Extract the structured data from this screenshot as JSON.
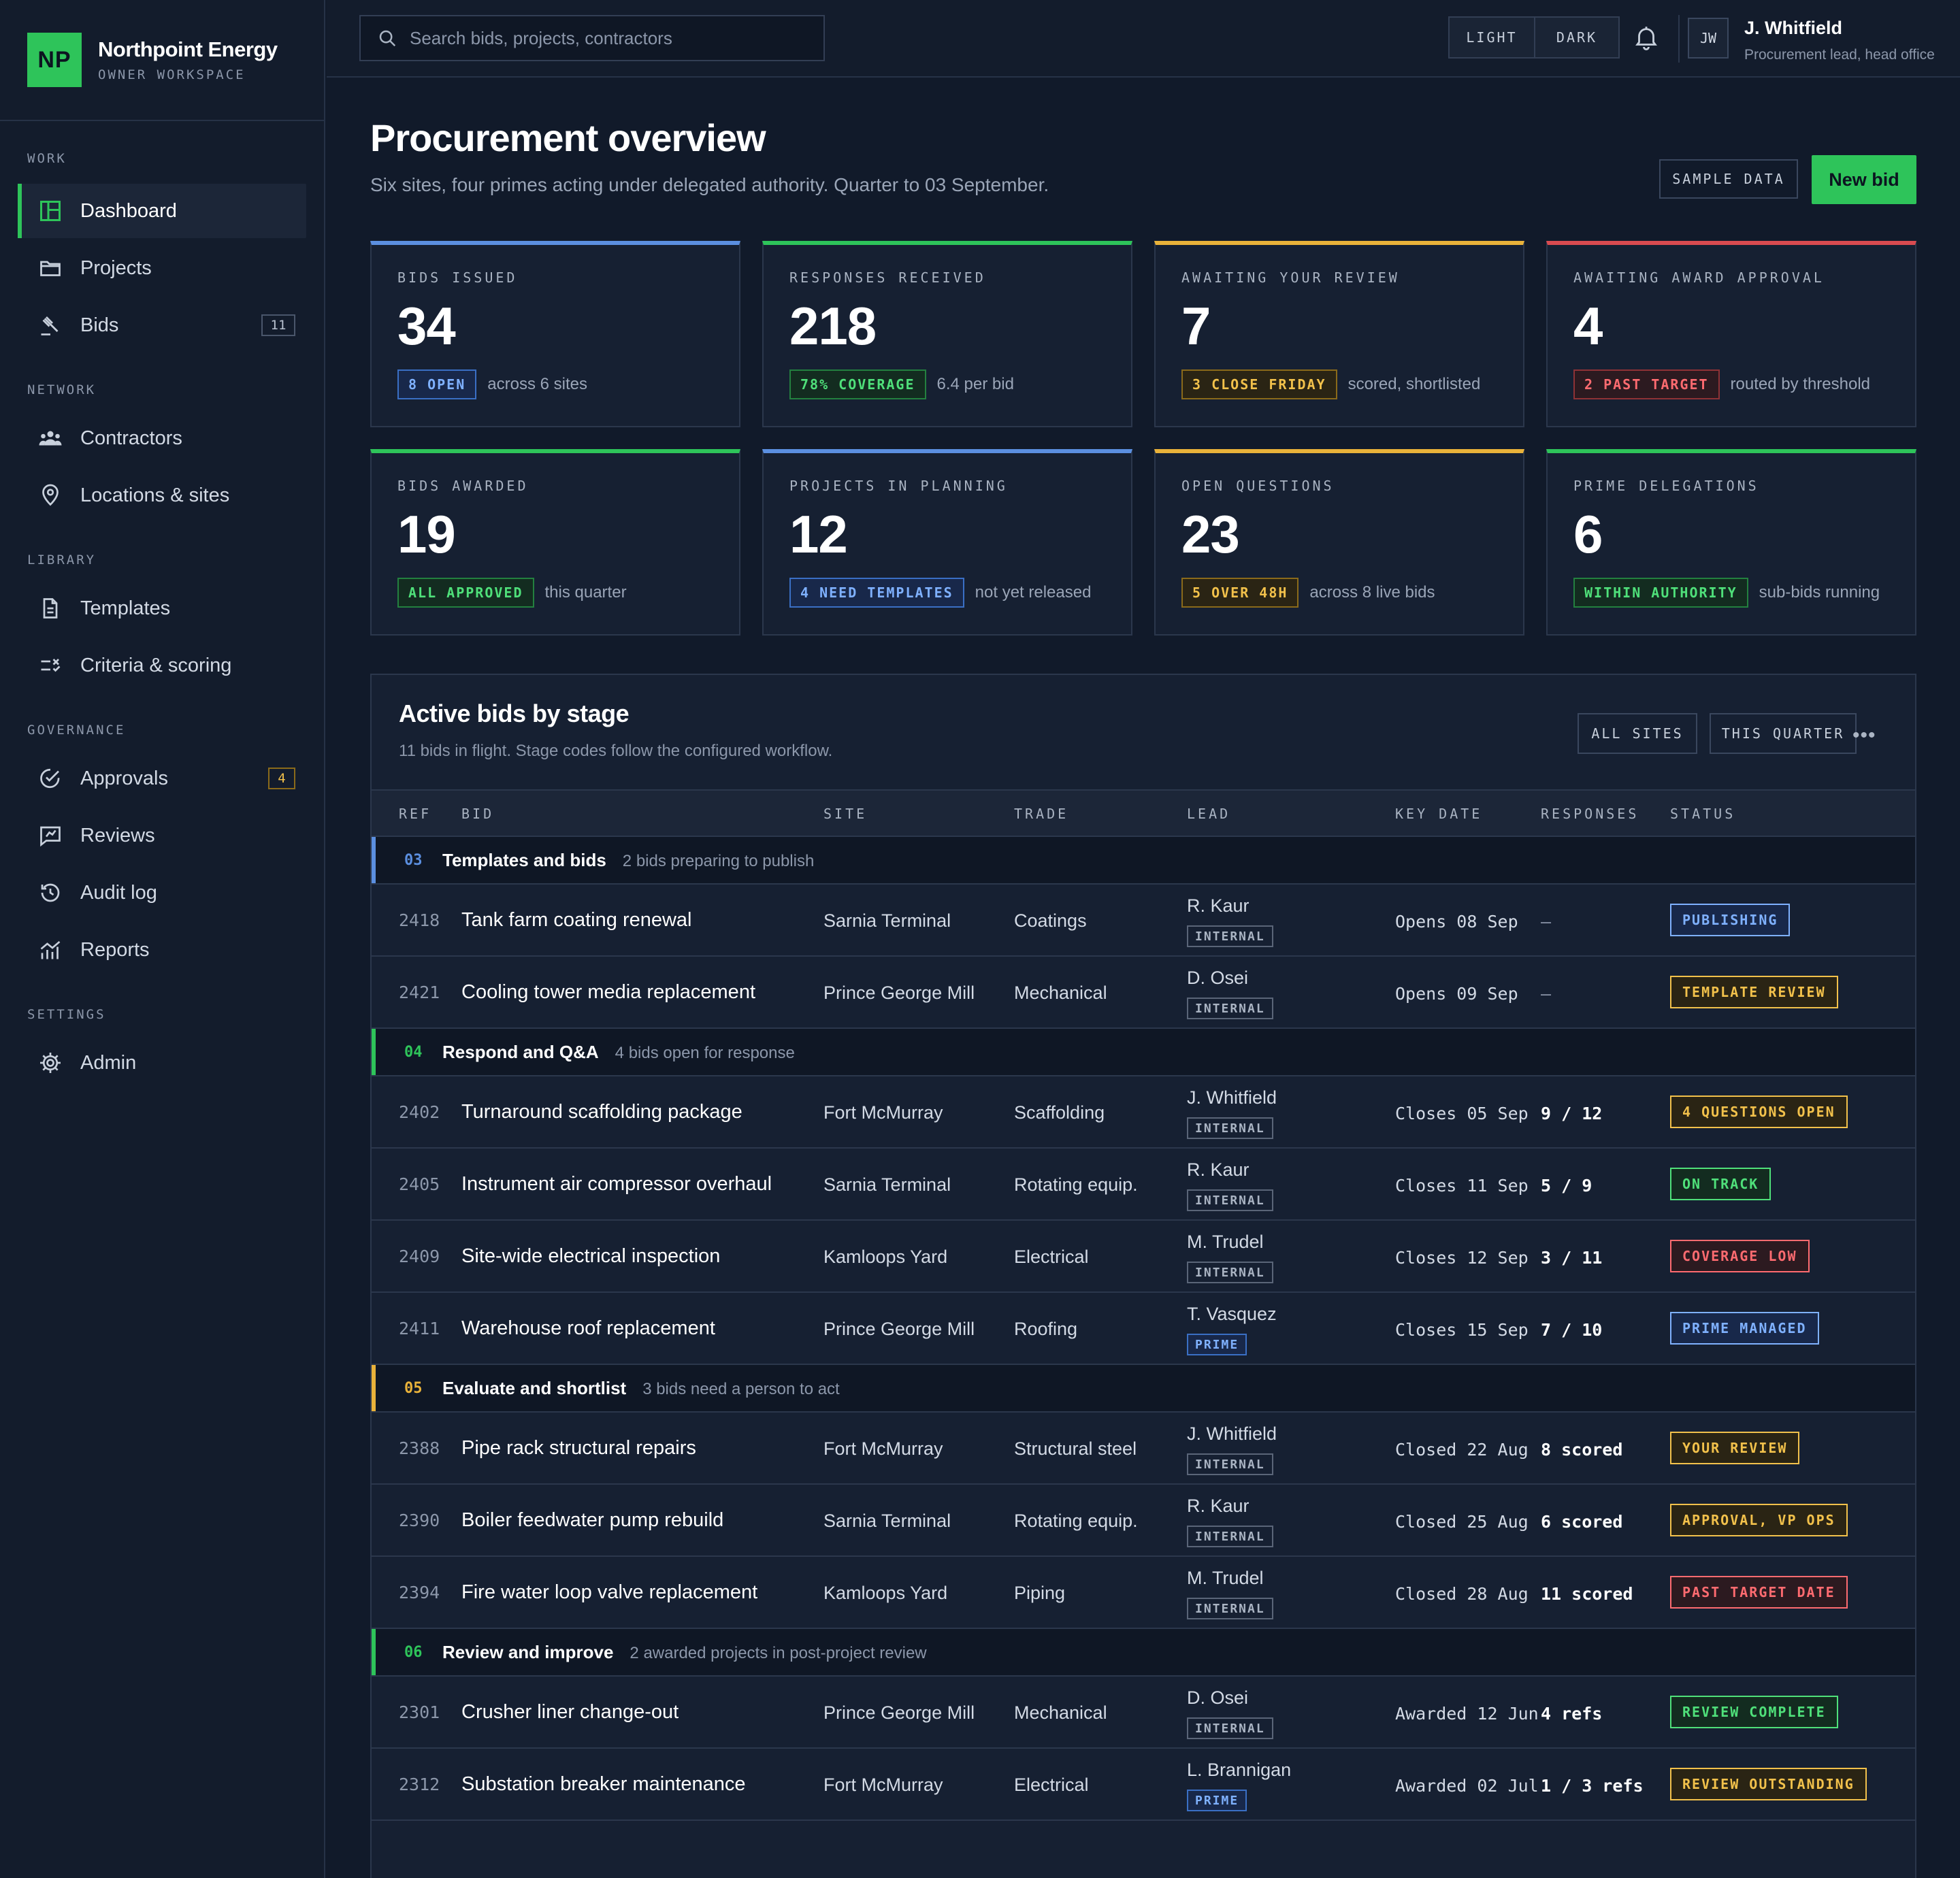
{
  "brand": {
    "logo": "NP",
    "name": "Northpoint Energy",
    "sub": "OWNER WORKSPACE"
  },
  "nav": {
    "work": {
      "heading": "WORK",
      "items": [
        {
          "label": "Dashboard",
          "icon": "dashboard-icon"
        },
        {
          "label": "Projects",
          "icon": "folder-icon"
        },
        {
          "label": "Bids",
          "icon": "gavel-icon",
          "count": "11"
        }
      ]
    },
    "network": {
      "heading": "NETWORK",
      "items": [
        {
          "label": "Contractors",
          "icon": "people-icon"
        },
        {
          "label": "Locations & sites",
          "icon": "map-pin-icon"
        }
      ]
    },
    "library": {
      "heading": "LIBRARY",
      "items": [
        {
          "label": "Templates",
          "icon": "document-icon"
        },
        {
          "label": "Criteria & scoring",
          "icon": "criteria-icon"
        }
      ]
    },
    "governance": {
      "heading": "GOVERNANCE",
      "items": [
        {
          "label": "Approvals",
          "icon": "check-circle-icon",
          "count": "4"
        },
        {
          "label": "Reviews",
          "icon": "review-icon"
        },
        {
          "label": "Audit log",
          "icon": "history-icon"
        },
        {
          "label": "Reports",
          "icon": "chart-icon"
        }
      ]
    },
    "settings": {
      "heading": "SETTINGS",
      "items": [
        {
          "label": "Admin",
          "icon": "gear-icon"
        }
      ]
    }
  },
  "topbar": {
    "search_placeholder": "Search bids, projects, contractors",
    "theme_light": "LIGHT",
    "theme_dark": "DARK",
    "user_initials": "JW",
    "user_name": "J. Whitfield",
    "user_role": "Procurement lead, head office"
  },
  "header": {
    "title": "Procurement overview",
    "subtitle": "Six sites, four primes acting under delegated authority. Quarter to 03 September.",
    "sample_label": "SAMPLE DATA",
    "new_bid_label": "New bid"
  },
  "kpis": [
    {
      "label": "BIDS ISSUED",
      "value": "34",
      "chip": "8 OPEN",
      "note": "across 6 sites",
      "color": "blue"
    },
    {
      "label": "RESPONSES RECEIVED",
      "value": "218",
      "chip": "78% COVERAGE",
      "note": "6.4 per bid",
      "color": "green"
    },
    {
      "label": "AWAITING YOUR REVIEW",
      "value": "7",
      "chip": "3 CLOSE FRIDAY",
      "note": "scored, shortlisted",
      "color": "amber"
    },
    {
      "label": "AWAITING AWARD APPROVAL",
      "value": "4",
      "chip": "2 PAST TARGET",
      "note": "routed by threshold",
      "color": "red"
    },
    {
      "label": "BIDS AWARDED",
      "value": "19",
      "chip": "ALL APPROVED",
      "note": "this quarter",
      "color": "green"
    },
    {
      "label": "PROJECTS IN PLANNING",
      "value": "12",
      "chip": "4 NEED TEMPLATES",
      "note": "not yet released",
      "color": "blue"
    },
    {
      "label": "OPEN QUESTIONS",
      "value": "23",
      "chip": "5 OVER 48H",
      "note": "across 8 live bids",
      "color": "amber"
    },
    {
      "label": "PRIME DELEGATIONS",
      "value": "6",
      "chip": "WITHIN AUTHORITY",
      "note": "sub-bids running",
      "color": "green"
    }
  ],
  "colors": {
    "blue": "#5b8fe0",
    "green": "#2ec45a",
    "amber": "#e9b23a",
    "red": "#d94b50"
  },
  "table": {
    "title": "Active bids by stage",
    "subtitle": "11 bids in flight. Stage codes follow the configured workflow.",
    "filter_sites": "ALL SITES",
    "filter_period": "THIS QUARTER",
    "more": "•••",
    "columns": [
      "REF",
      "BID",
      "SITE",
      "TRADE",
      "LEAD",
      "KEY DATE",
      "RESPONSES",
      "STATUS"
    ],
    "stages": [
      {
        "code": "03",
        "name": "Templates and bids",
        "desc": "2 bids preparing to publish",
        "color": "blue",
        "rows": [
          {
            "ref": "2418",
            "bid": "Tank farm coating renewal",
            "site": "Sarnia Terminal",
            "trade": "Coatings",
            "lead": "R. Kaur",
            "lead_tag": "INTERNAL",
            "key_date": "Opens 08 Sep",
            "responses": "—",
            "status": "PUBLISHING",
            "status_color": "blue"
          },
          {
            "ref": "2421",
            "bid": "Cooling tower media replacement",
            "site": "Prince George Mill",
            "trade": "Mechanical",
            "lead": "D. Osei",
            "lead_tag": "INTERNAL",
            "key_date": "Opens 09 Sep",
            "responses": "—",
            "status": "TEMPLATE REVIEW",
            "status_color": "amber"
          }
        ]
      },
      {
        "code": "04",
        "name": "Respond and Q&A",
        "desc": "4 bids open for response",
        "color": "green",
        "rows": [
          {
            "ref": "2402",
            "bid": "Turnaround scaffolding package",
            "site": "Fort McMurray",
            "trade": "Scaffolding",
            "lead": "J. Whitfield",
            "lead_tag": "INTERNAL",
            "key_date": "Closes 05 Sep",
            "responses": "9 / 12",
            "status": "4 QUESTIONS OPEN",
            "status_color": "amber"
          },
          {
            "ref": "2405",
            "bid": "Instrument air compressor overhaul",
            "site": "Sarnia Terminal",
            "trade": "Rotating equip.",
            "lead": "R. Kaur",
            "lead_tag": "INTERNAL",
            "key_date": "Closes 11 Sep",
            "responses": "5 / 9",
            "status": "ON TRACK",
            "status_color": "green"
          },
          {
            "ref": "2409",
            "bid": "Site-wide electrical inspection",
            "site": "Kamloops Yard",
            "trade": "Electrical",
            "lead": "M. Trudel",
            "lead_tag": "INTERNAL",
            "key_date": "Closes 12 Sep",
            "responses": "3 / 11",
            "status": "COVERAGE LOW",
            "status_color": "red"
          },
          {
            "ref": "2411",
            "bid": "Warehouse roof replacement",
            "site": "Prince George Mill",
            "trade": "Roofing",
            "lead": "T. Vasquez",
            "lead_tag": "PRIME",
            "key_date": "Closes 15 Sep",
            "responses": "7 / 10",
            "status": "PRIME MANAGED",
            "status_color": "blue"
          }
        ]
      },
      {
        "code": "05",
        "name": "Evaluate and shortlist",
        "desc": "3 bids need a person to act",
        "color": "amber",
        "rows": [
          {
            "ref": "2388",
            "bid": "Pipe rack structural repairs",
            "site": "Fort McMurray",
            "trade": "Structural steel",
            "lead": "J. Whitfield",
            "lead_tag": "INTERNAL",
            "key_date": "Closed 22 Aug",
            "responses": "8 scored",
            "status": "YOUR REVIEW",
            "status_color": "amber"
          },
          {
            "ref": "2390",
            "bid": "Boiler feedwater pump rebuild",
            "site": "Sarnia Terminal",
            "trade": "Rotating equip.",
            "lead": "R. Kaur",
            "lead_tag": "INTERNAL",
            "key_date": "Closed 25 Aug",
            "responses": "6 scored",
            "status": "APPROVAL, VP OPS",
            "status_color": "amber"
          },
          {
            "ref": "2394",
            "bid": "Fire water loop valve replacement",
            "site": "Kamloops Yard",
            "trade": "Piping",
            "lead": "M. Trudel",
            "lead_tag": "INTERNAL",
            "key_date": "Closed 28 Aug",
            "responses": "11 scored",
            "status": "PAST TARGET DATE",
            "status_color": "red"
          }
        ]
      },
      {
        "code": "06",
        "name": "Review and improve",
        "desc": "2 awarded projects in post-project review",
        "color": "green",
        "rows": [
          {
            "ref": "2301",
            "bid": "Crusher liner change-out",
            "site": "Prince George Mill",
            "trade": "Mechanical",
            "lead": "D. Osei",
            "lead_tag": "INTERNAL",
            "key_date": "Awarded 12 Jun",
            "responses": "4 refs",
            "status": "REVIEW COMPLETE",
            "status_color": "green"
          },
          {
            "ref": "2312",
            "bid": "Substation breaker maintenance",
            "site": "Fort McMurray",
            "trade": "Electrical",
            "lead": "L. Brannigan",
            "lead_tag": "PRIME",
            "key_date": "Awarded 02 Jul",
            "responses": "1 / 3 refs",
            "status": "REVIEW OUTSTANDING",
            "status_color": "amber"
          }
        ]
      }
    ]
  }
}
